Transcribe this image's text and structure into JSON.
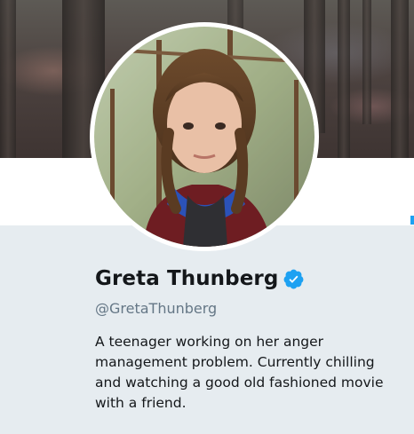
{
  "profile": {
    "display_name": "Greta Thunberg",
    "handle": "@GretaThunberg",
    "bio": "A teenager working on her anger management problem. Currently chilling and watching a good old fashioned movie with a friend."
  },
  "icons": {
    "verified": "verified-badge-icon"
  },
  "colors": {
    "background": "#e6ecf0",
    "verified": "#1da1f2",
    "text": "#14171a",
    "handle": "#657786"
  }
}
